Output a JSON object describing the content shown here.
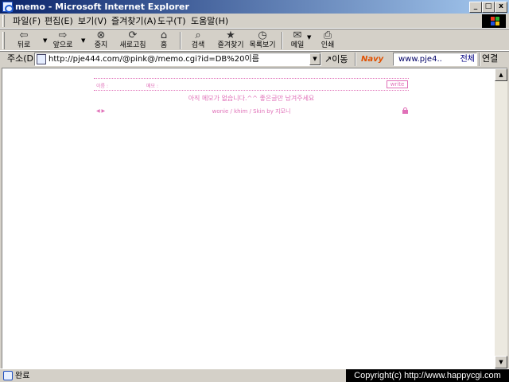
{
  "window": {
    "title": "memo - Microsoft Internet Explorer",
    "minimize": "_",
    "maximize": "□",
    "close": "x"
  },
  "menu": [
    "파일(F)",
    "편집(E)",
    "보기(V)",
    "즐겨찾기(A)",
    "도구(T)",
    "도움말(H)"
  ],
  "toolbar": {
    "back": "뒤로",
    "forward": "앞으로",
    "stop": "중지",
    "refresh": "새로고침",
    "home": "홈",
    "search": "검색",
    "favorites": "즐겨찾기",
    "history": "목록보기",
    "mail": "메일",
    "print": "인쇄"
  },
  "address": {
    "label": "주소(D)",
    "url": "http://pje444.com/@pink@/memo.cgi?id=DB%20이름",
    "go": "이동",
    "navy_logo": "Navy",
    "navy_value": "www.pje4..",
    "navy_all": "전체",
    "links": "연결"
  },
  "memo": {
    "name_label": "이름 :",
    "memo_label": "메모 :",
    "write": "write",
    "empty_message": "아직 메모가 없습니다.^^ 좋은글만 남겨주세요",
    "nav": "◀ ▶",
    "credits": "wonie / khim / Skin by 지모니"
  },
  "status": {
    "text": "완료",
    "copyright": "Copyright(c) http://www.happycgi.com"
  },
  "colors": {
    "accent": "#e070b8",
    "titlebar_start": "#0a246a",
    "titlebar_end": "#a6caf0",
    "chrome": "#d4d0c8"
  }
}
